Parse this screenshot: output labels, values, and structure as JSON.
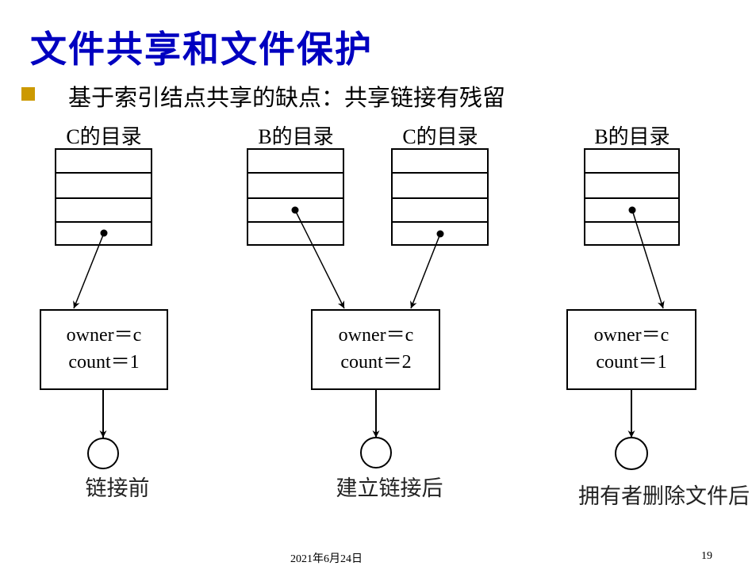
{
  "slide": {
    "title": "文件共享和文件保护",
    "bullet": "基于索引结点共享的缺点：共享链接有残留",
    "bullet_color": "#cc9900",
    "title_color": "#0000c0"
  },
  "panels": [
    {
      "directories": [
        {
          "label": "C的目录",
          "entries": 4,
          "pointer_entry": 4
        }
      ],
      "inode": {
        "owner_line": "owner＝c",
        "count_line": "count＝1"
      },
      "caption": "链接前"
    },
    {
      "directories": [
        {
          "label": "B的目录",
          "entries": 4,
          "pointer_entry": 3
        },
        {
          "label": "C的目录",
          "entries": 4,
          "pointer_entry": 4
        }
      ],
      "inode": {
        "owner_line": "owner＝c",
        "count_line": "count＝2"
      },
      "caption": "建立链接后"
    },
    {
      "directories": [
        {
          "label": "B的目录",
          "entries": 4,
          "pointer_entry": 3
        }
      ],
      "inode": {
        "owner_line": "owner＝c",
        "count_line": "count＝1"
      },
      "caption": "拥有者删除文件后"
    }
  ],
  "footer": {
    "date": "2021年6月24日",
    "page_number": "19"
  }
}
